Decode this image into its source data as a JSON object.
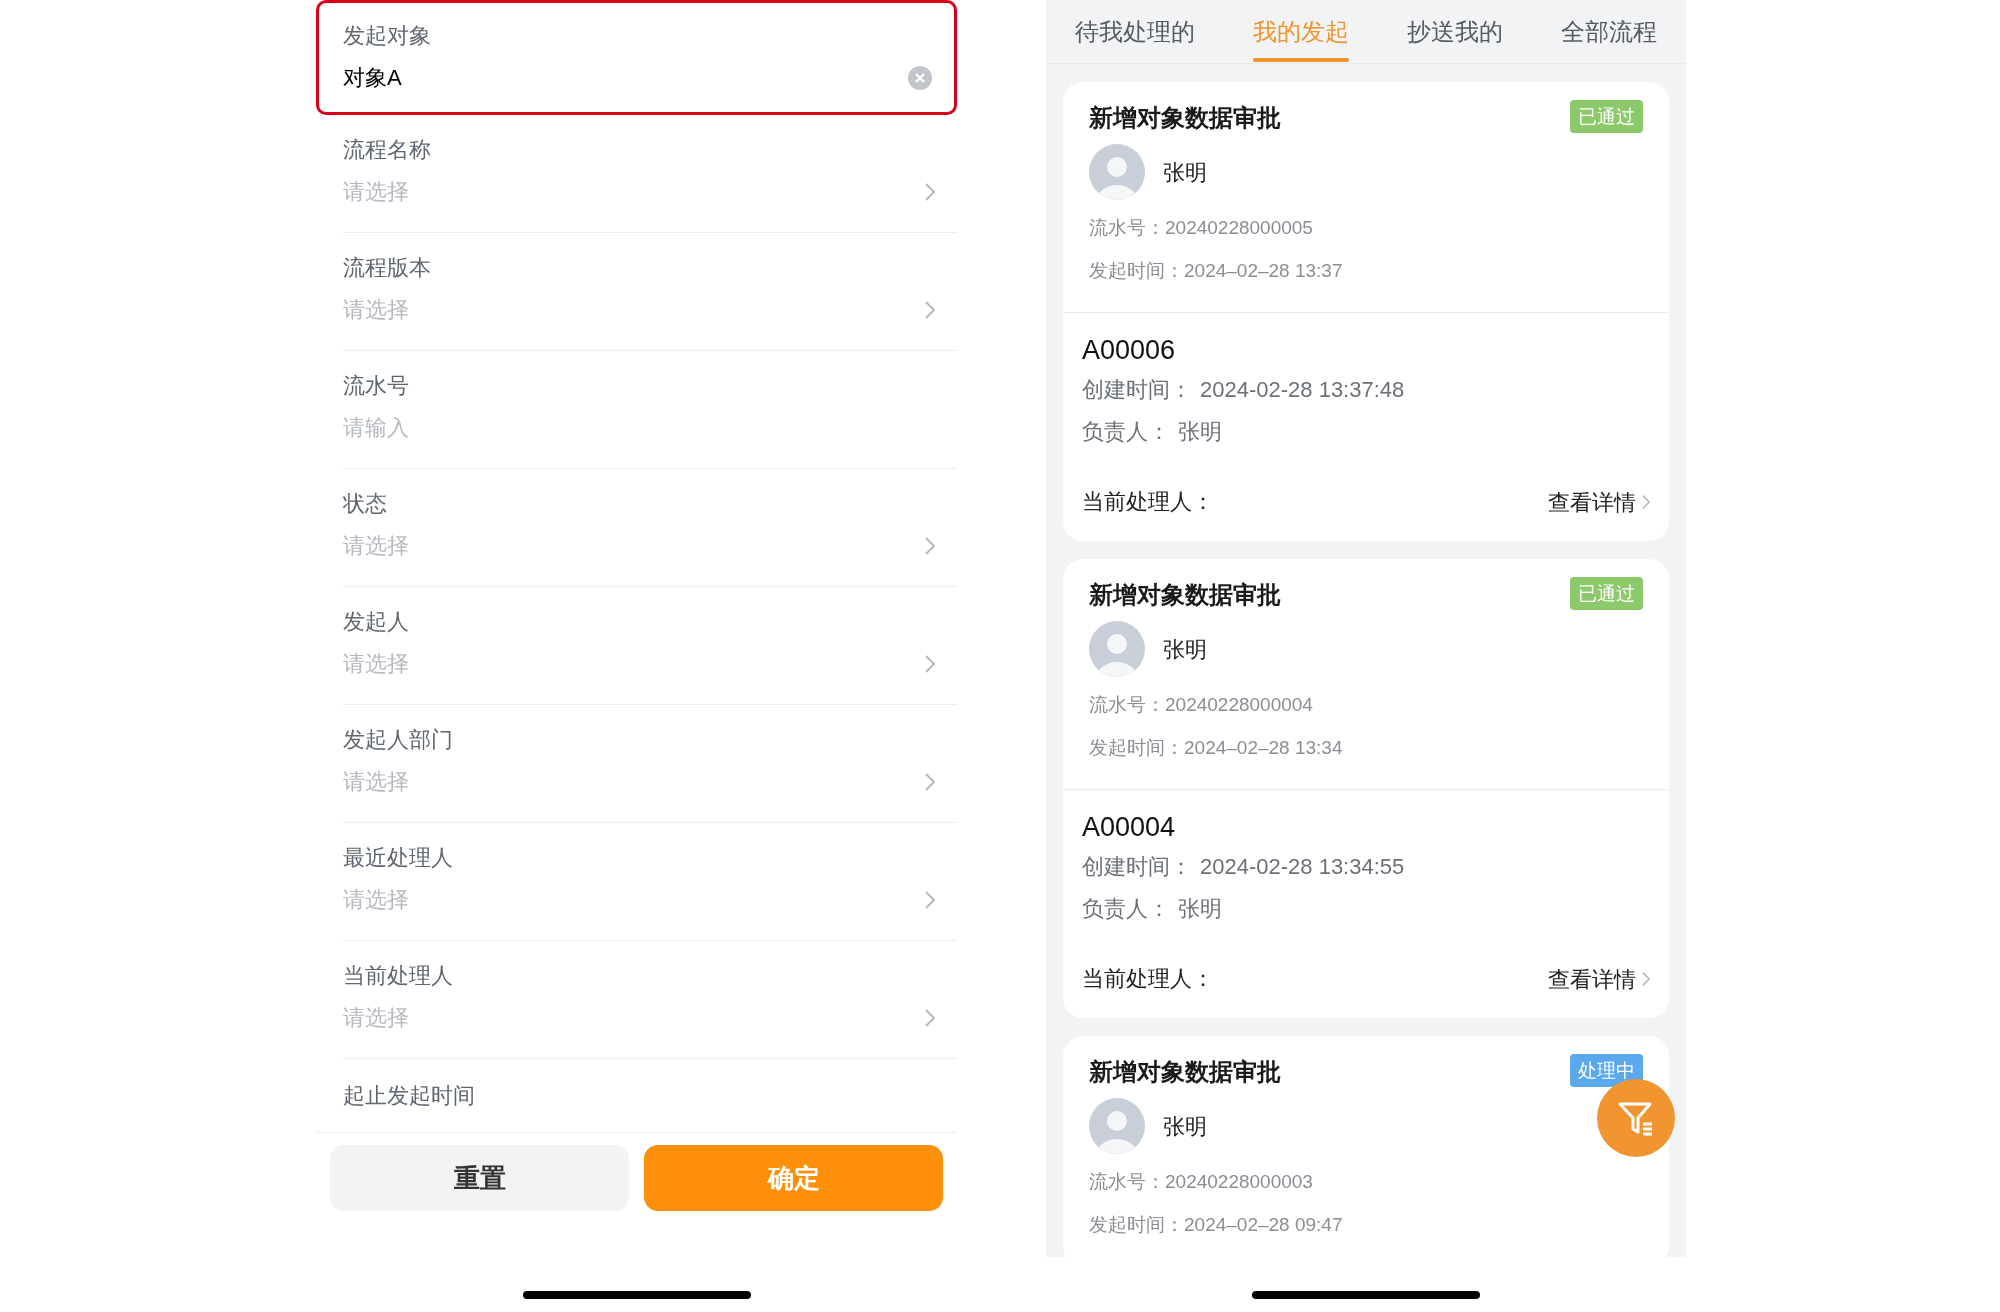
{
  "filter_form": {
    "fields": [
      {
        "kind": "text",
        "label": "发起对象",
        "value": "对象A",
        "highlighted": true
      },
      {
        "kind": "select",
        "label": "流程名称",
        "placeholder": "请选择",
        "highlighted": false
      },
      {
        "kind": "select",
        "label": "流程版本",
        "placeholder": "请选择",
        "highlighted": false
      },
      {
        "kind": "input",
        "label": "流水号",
        "placeholder": "请输入",
        "highlighted": false
      },
      {
        "kind": "select",
        "label": "状态",
        "placeholder": "请选择",
        "highlighted": false
      },
      {
        "kind": "select",
        "label": "发起人",
        "placeholder": "请选择",
        "highlighted": false
      },
      {
        "kind": "select",
        "label": "发起人部门",
        "placeholder": "请选择",
        "highlighted": false
      },
      {
        "kind": "select",
        "label": "最近处理人",
        "placeholder": "请选择",
        "highlighted": false
      },
      {
        "kind": "select",
        "label": "当前处理人",
        "placeholder": "请选择",
        "highlighted": false
      },
      {
        "kind": "heading",
        "label": "起止发起时间",
        "highlighted": false
      }
    ],
    "buttons": [
      {
        "kind": "secondary",
        "label": "重置"
      },
      {
        "kind": "primary",
        "label": "确定"
      }
    ]
  },
  "process_list": {
    "tabs": [
      {
        "label": "待我处理的",
        "selected": false
      },
      {
        "label": "我的发起",
        "selected": true
      },
      {
        "label": "抄送我的",
        "selected": false
      },
      {
        "label": "全部流程",
        "selected": false
      }
    ],
    "cards": [
      {
        "title": "新增对象数据审批",
        "status": {
          "label": "已通过",
          "color": "#8bc96a"
        },
        "initiator": "张明",
        "serial_label": "流水号：",
        "serial": "20240228000005",
        "time_label": "发起时间：",
        "time": "2024–02–28 13:37",
        "detail": {
          "code": "A00006",
          "created_label": "创建时间：",
          "created": "2024-02-28 13:37:48",
          "owner_label": "负责人：",
          "owner": "张明",
          "handler_label": "当前处理人：",
          "link": "查看详情"
        }
      },
      {
        "title": "新增对象数据审批",
        "status": {
          "label": "已通过",
          "color": "#8bc96a"
        },
        "initiator": "张明",
        "serial_label": "流水号：",
        "serial": "20240228000004",
        "time_label": "发起时间：",
        "time": "2024–02–28 13:34",
        "detail": {
          "code": "A00004",
          "created_label": "创建时间：",
          "created": "2024-02-28 13:34:55",
          "owner_label": "负责人：",
          "owner": "张明",
          "handler_label": "当前处理人：",
          "link": "查看详情"
        }
      },
      {
        "title": "新增对象数据审批",
        "status": {
          "label": "处理中",
          "color": "#5aa9ec"
        },
        "initiator": "张明",
        "serial_label": "流水号：",
        "serial": "20240228000003",
        "time_label": "发起时间：",
        "time": "2024–02–28 09:47"
      }
    ]
  }
}
